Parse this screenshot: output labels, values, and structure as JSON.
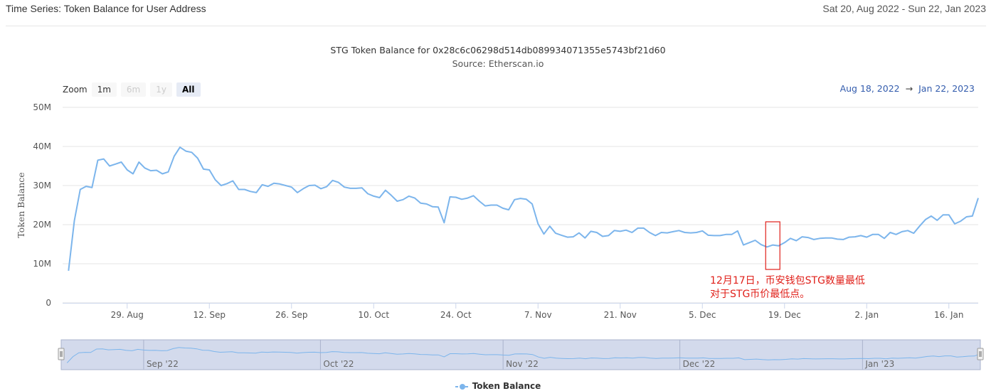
{
  "header": {
    "title": "Time Series: Token Balance for User Address",
    "date_range": "Sat 20, Aug 2022 - Sun 22, Jan 2023"
  },
  "zoom": {
    "label": "Zoom",
    "buttons": [
      {
        "label": "1m",
        "state": "normal"
      },
      {
        "label": "6m",
        "state": "disabled"
      },
      {
        "label": "1y",
        "state": "disabled"
      },
      {
        "label": "All",
        "state": "active"
      }
    ]
  },
  "range_selector": {
    "from": "Aug 18, 2022",
    "arrow": "→",
    "to": "Jan 22, 2023"
  },
  "annotation": {
    "line1": "12月17日，币安钱包STG数量最低",
    "line2": "对于STG币价最低点。",
    "color": "#e0201a"
  },
  "colors": {
    "series": "#7cb5ec",
    "navigator_fill": "#c4cde6",
    "grid": "#e6e6e6"
  },
  "chart_data": {
    "type": "line",
    "title": "STG Token Balance for 0x28c6c06298d514db089934071355e5743bf21d60",
    "subtitle": "Source: Etherscan.io",
    "ylabel": "Token Balance",
    "xlabel": "",
    "ylim": [
      0,
      50000000
    ],
    "y_ticks": [
      "0",
      "10M",
      "20M",
      "30M",
      "40M",
      "50M"
    ],
    "x_ticks": [
      "29. Aug",
      "12. Sep",
      "26. Sep",
      "10. Oct",
      "24. Oct",
      "7. Nov",
      "21. Nov",
      "5. Dec",
      "19. Dec",
      "2. Jan",
      "16. Jan"
    ],
    "x_tick_days": [
      11,
      25,
      39,
      53,
      67,
      81,
      95,
      109,
      123,
      137,
      151
    ],
    "xlim_days": [
      0,
      156
    ],
    "x_day0": "18 Aug 2022",
    "navigator_labels": [
      "Sep '22",
      "Oct '22",
      "Nov '22",
      "Dec '22",
      "Jan '23"
    ],
    "navigator_label_days": [
      14,
      44,
      75,
      105,
      136
    ],
    "grid": true,
    "legend_position": "bottom-center",
    "series": [
      {
        "name": "Token Balance",
        "x_days": [
          1,
          2,
          3,
          4,
          5,
          6,
          7,
          8,
          9,
          10,
          11,
          12,
          13,
          14,
          15,
          16,
          17,
          18,
          19,
          20,
          21,
          22,
          23,
          24,
          25,
          26,
          27,
          28,
          29,
          30,
          31,
          32,
          33,
          34,
          35,
          36,
          37,
          38,
          39,
          40,
          41,
          42,
          43,
          44,
          45,
          46,
          47,
          48,
          49,
          50,
          51,
          52,
          53,
          54,
          55,
          56,
          57,
          58,
          59,
          60,
          61,
          62,
          63,
          64,
          65,
          66,
          67,
          68,
          69,
          70,
          71,
          72,
          73,
          74,
          75,
          76,
          77,
          78,
          79,
          80,
          81,
          82,
          83,
          84,
          85,
          86,
          87,
          88,
          89,
          90,
          91,
          92,
          93,
          94,
          95,
          96,
          97,
          98,
          99,
          100,
          101,
          102,
          103,
          104,
          105,
          106,
          107,
          108,
          109,
          110,
          111,
          112,
          113,
          114,
          115,
          116,
          117,
          118,
          119,
          120,
          121,
          122,
          123,
          124,
          125,
          126,
          127,
          128,
          129,
          130,
          131,
          132,
          133,
          134,
          135,
          136,
          137,
          138,
          139,
          140,
          141,
          142,
          143,
          144,
          145,
          146,
          147,
          148,
          149,
          150,
          151,
          152,
          153,
          154,
          155,
          156
        ],
        "values": [
          8200000,
          21000000,
          29000000,
          29800000,
          29500000,
          36500000,
          36800000,
          35000000,
          35500000,
          36000000,
          34000000,
          33000000,
          36000000,
          34500000,
          33800000,
          33900000,
          33000000,
          33500000,
          37500000,
          39800000,
          38800000,
          38500000,
          37000000,
          34200000,
          34000000,
          31500000,
          30000000,
          30500000,
          31200000,
          29000000,
          29000000,
          28500000,
          28200000,
          30200000,
          29800000,
          30600000,
          30400000,
          30000000,
          29600000,
          28200000,
          29200000,
          30000000,
          30100000,
          29200000,
          29700000,
          31300000,
          30800000,
          29600000,
          29300000,
          29300000,
          29400000,
          27900000,
          27300000,
          26900000,
          28800000,
          27500000,
          26000000,
          26400000,
          27300000,
          26800000,
          25500000,
          25300000,
          24600000,
          24500000,
          20500000,
          27100000,
          27000000,
          26500000,
          26800000,
          27400000,
          26000000,
          24800000,
          25000000,
          25000000,
          24200000,
          23800000,
          26400000,
          26700000,
          26500000,
          25300000,
          20200000,
          17600000,
          19600000,
          17800000,
          17300000,
          16800000,
          16900000,
          17900000,
          16600000,
          18300000,
          18000000,
          17000000,
          17200000,
          18500000,
          18300000,
          18600000,
          18000000,
          19100000,
          19100000,
          18000000,
          17200000,
          18000000,
          17900000,
          18200000,
          18500000,
          18000000,
          17900000,
          18000000,
          18400000,
          17300000,
          17200000,
          17200000,
          17500000,
          17500000,
          18400000,
          14800000,
          15400000,
          16000000,
          14900000,
          14300000,
          14800000,
          14600000,
          15400000,
          16500000,
          15900000,
          16900000,
          16700000,
          16200000,
          16500000,
          16600000,
          16600000,
          16300000,
          16200000,
          16800000,
          16900000,
          17200000,
          16800000,
          17500000,
          17500000,
          16500000,
          18000000,
          17500000,
          18200000,
          18500000,
          17800000,
          19600000,
          21300000,
          22200000,
          21100000,
          22500000,
          22500000,
          20200000,
          20900000,
          22000000,
          22200000,
          26800000
        ]
      }
    ]
  }
}
